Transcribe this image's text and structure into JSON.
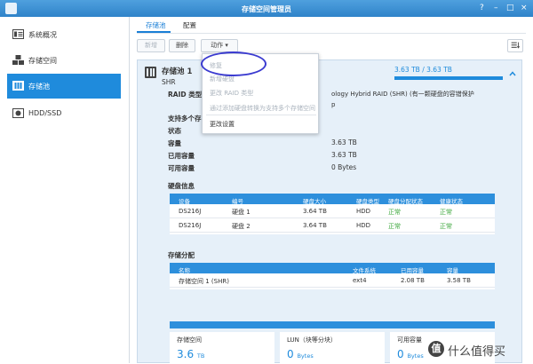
{
  "window": {
    "title": "存储空间管理员",
    "help": "?",
    "minimize": "–",
    "maximize": "□",
    "close": "×"
  },
  "sidebar": {
    "items": [
      {
        "label": "系统概况",
        "icon": "overview-icon",
        "active": false
      },
      {
        "label": "存储空间",
        "icon": "volume-icon",
        "active": false
      },
      {
        "label": "存储池",
        "icon": "storage-pool-icon",
        "active": true
      },
      {
        "label": "HDD/SSD",
        "icon": "hdd-icon",
        "active": false
      }
    ]
  },
  "tabs": [
    {
      "label": "存储池",
      "active": true
    },
    {
      "label": "配置",
      "active": false
    }
  ],
  "toolbar": {
    "new": "新增",
    "delete": "删除",
    "action": "动作 ▾"
  },
  "pool": {
    "name": "存储池 1",
    "type": "SHR",
    "capacity_text": "3.63 TB / 3.63 TB",
    "capacity_fraction": 1.0,
    "raid_label": "RAID 类型",
    "raid_value": "ology Hybrid RAID (SHR) (有一颗硬盘的容错保护",
    "raid_value2": "p",
    "multi_label": "支持多个存",
    "status_label": "状态",
    "capacity_label": "容量",
    "capacity_value": "3.63 TB",
    "used_label": "已用容量",
    "used_value": "3.63 TB",
    "avail_label": "可用容量",
    "avail_value": "0 Bytes"
  },
  "disk_info": {
    "title": "硬盘信息",
    "headers": [
      "设备",
      "编号",
      "硬盘大小",
      "硬盘类型",
      "硬盘分配状态",
      "健康状态"
    ],
    "rows": [
      [
        "DS216J",
        "硬盘 1",
        "3.64 TB",
        "HDD",
        "正常",
        "正常"
      ],
      [
        "DS216J",
        "硬盘 2",
        "3.64 TB",
        "HDD",
        "正常",
        "正常"
      ]
    ]
  },
  "allocation": {
    "title": "存储分配",
    "headers": [
      "名称",
      "文件系统",
      "已用容量",
      "容量"
    ],
    "rows": [
      [
        "存储空间 1 (SHR)",
        "ext4",
        "2.08 TB",
        "3.58 TB"
      ]
    ]
  },
  "summary": [
    {
      "label": "存储空间",
      "value": "3.6",
      "unit": "TB"
    },
    {
      "label": "LUN（块等分块）",
      "value": "0",
      "unit": "Bytes"
    },
    {
      "label": "可用容量",
      "value": "0",
      "unit": "Bytes"
    }
  ],
  "menu": {
    "items": [
      {
        "label": "修复",
        "disabled": true
      },
      {
        "label": "新增硬盘",
        "disabled": true
      },
      {
        "label": "更改 RAID 类型",
        "disabled": true
      },
      {
        "label": "通过添加硬盘转换为支持多个存储空间",
        "disabled": true
      },
      {
        "label": "更改设置",
        "disabled": false
      }
    ]
  },
  "watermark": {
    "icon_text": "值",
    "text": "什么值得买"
  },
  "colors": {
    "accent": "#1f8bdc",
    "ok": "#3fa83f",
    "panel": "#e6f0f9",
    "annotation": "#3b3bd0"
  }
}
